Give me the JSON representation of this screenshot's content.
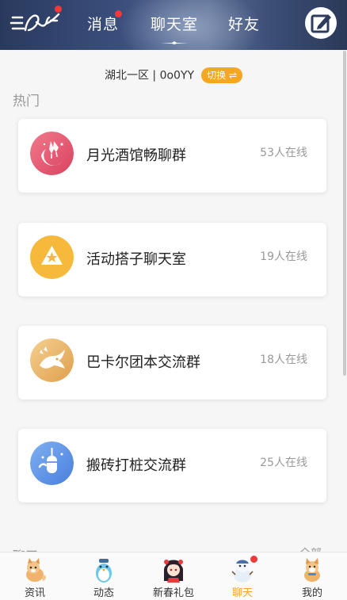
{
  "header": {
    "tabs": [
      {
        "label": "消息",
        "has_badge": true
      },
      {
        "label": "聊天室",
        "active": true
      },
      {
        "label": "好友"
      }
    ],
    "logo_badge": true
  },
  "server": {
    "info": "湖北一区 | 0o0YY",
    "switch_label": "切换 ⇌"
  },
  "hot_section_title": "热门",
  "rooms": [
    {
      "name": "月光酒馆畅聊群",
      "online": "53人在线",
      "icon": "moon-glasses-icon",
      "color": "#e8576f"
    },
    {
      "name": "活动搭子聊天室",
      "online": "19人在线",
      "icon": "triangle-star-icon",
      "color": "#f6b93b"
    },
    {
      "name": "巴卡尔团本交流群",
      "online": "18人在线",
      "icon": "dragon-icon",
      "color": "#e9b96a"
    },
    {
      "name": "搬砖打桩交流群",
      "online": "25人在线",
      "icon": "punching-bag-icon",
      "color": "#5b8fe6"
    }
  ],
  "chat_section": {
    "title": "聊天",
    "all_label": "全部 ›"
  },
  "bottom_nav": [
    {
      "label": "资讯",
      "icon": "fox-mascot-icon"
    },
    {
      "label": "动态",
      "icon": "penguin-mascot-icon"
    },
    {
      "label": "新春礼包",
      "icon": "girl-character-icon"
    },
    {
      "label": "聊天",
      "icon": "snowman-mascot-icon",
      "active": true,
      "has_badge": true
    },
    {
      "label": "我的",
      "icon": "corgi-mascot-icon"
    }
  ],
  "colors": {
    "accent": "#f5a623",
    "badge": "#f03a3a"
  }
}
